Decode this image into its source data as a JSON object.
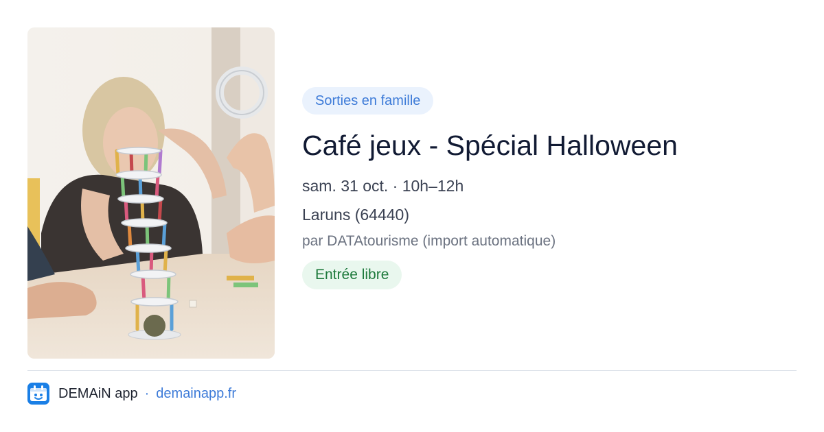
{
  "event": {
    "category": "Sorties en famille",
    "title": "Café jeux - Spécial Halloween",
    "datetime": "sam. 31 oct. · 10h–12h",
    "location": "Laruns (64440)",
    "source": "par DATAtourisme (import automatique)",
    "price": "Entrée libre"
  },
  "footer": {
    "app_name": "DEMAiN app",
    "separator": "·",
    "link": "demainapp.fr"
  },
  "icons": {
    "app_logo": "demain-app-logo-icon"
  },
  "colors": {
    "category_text": "#3d7bd8",
    "category_bg": "#eaf2fd",
    "price_text": "#1e7a3c",
    "price_bg": "#e9f7ee",
    "title": "#111a33",
    "link": "#3d7bd8"
  }
}
